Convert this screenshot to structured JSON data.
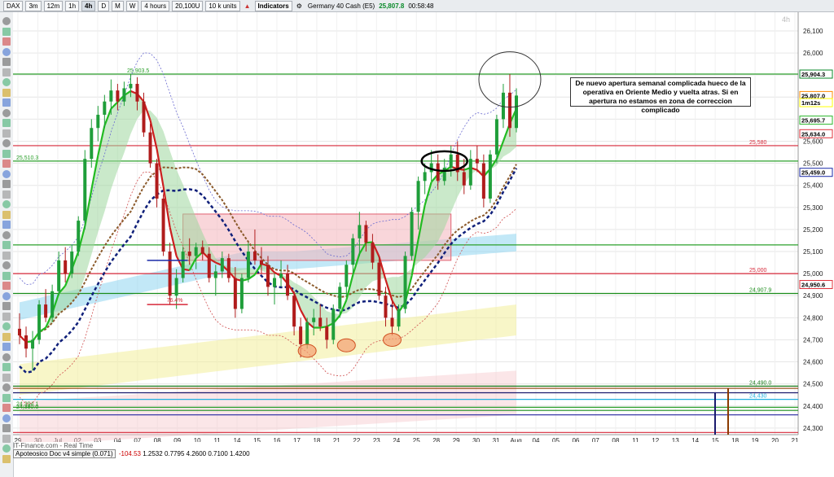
{
  "toolbar": {
    "instrument": "DAX",
    "timeframes": [
      "3m",
      "12m",
      "1h",
      "4h",
      "D",
      "M",
      "W"
    ],
    "selected_timeframe": "4h",
    "period": "4 hours",
    "quantity": "20,100U",
    "units": "10 k units",
    "indicators_label": "Indicators",
    "instrument_full": "Germany 40 Cash (E5)",
    "price": "25,807.8",
    "countdown": "00:58:48"
  },
  "watermark": "4h",
  "annotation_text": "De nuevo apertura semanal complicada  hueco de la operativa en Oriente Medio y vuelta atras. Si en apertura no estamos en zona de correccion complicado",
  "footer": {
    "source": "IT-Finance.com - Real Time",
    "indicator_name": "Apoteosico Doc v4 simple (0.071)",
    "values": [
      "-104.53",
      "1.2532",
      "0.7795",
      "4.2600",
      "0.7100",
      "1.4200"
    ]
  },
  "chart_data": {
    "type": "candlestick",
    "instrument": "DAX",
    "timeframe": "4h",
    "x_axis_labels": [
      "29",
      "30",
      "Jul",
      "02",
      "03",
      "04",
      "07",
      "08",
      "09",
      "10",
      "11",
      "14",
      "15",
      "16",
      "17",
      "18",
      "21",
      "22",
      "23",
      "24",
      "25",
      "28",
      "29",
      "30",
      "31",
      "Aug",
      "04",
      "05",
      "06",
      "07",
      "08",
      "11",
      "12",
      "13",
      "14",
      "15",
      "18",
      "19",
      "20",
      "21"
    ],
    "y_axis_ticks": [
      "26,100",
      "26,000",
      "25,900",
      "25,800",
      "25,700",
      "25,600",
      "25,500",
      "25,400",
      "25,300",
      "25,200",
      "25,100",
      "25,000",
      "24,900",
      "24,800",
      "24,700",
      "24,600",
      "24,500",
      "24,400",
      "24,300"
    ],
    "ylim": [
      24270,
      26170
    ],
    "price_tags": [
      {
        "text": "25,904.3",
        "value": 25904.3,
        "color": "#0a8a2a"
      },
      {
        "text": "25,807.0",
        "value": 25807,
        "color": "#ff8c00"
      },
      {
        "text": "1m12s",
        "value": 25775,
        "color": "#ffff00"
      },
      {
        "text": "25,695.7",
        "value": 25695.7,
        "color": "#2eb82e"
      },
      {
        "text": "25,634.0",
        "value": 25634,
        "color": "#e0303a"
      },
      {
        "text": "25,459.0",
        "value": 25459,
        "color": "#1a2aa8"
      },
      {
        "text": "24,950.6",
        "value": 24950.6,
        "color": "#e0303a"
      }
    ],
    "horizontal_levels": [
      {
        "value": 25904.3,
        "color": "#2ca02c",
        "label": "25,903.5"
      },
      {
        "value": 25580,
        "color": "#d62839",
        "label": "25,580"
      },
      {
        "value": 25510,
        "color": "#2ca02c",
        "label": "25,510.3"
      },
      {
        "value": 25130,
        "color": "#2ca02c",
        "label": ""
      },
      {
        "value": 25000,
        "color": "#d62839",
        "label": "25,000"
      },
      {
        "value": 24910,
        "color": "#1a8c1a",
        "label": "24,907.9"
      },
      {
        "value": 24490,
        "color": "#1a7a1a",
        "label": "24,490.0"
      },
      {
        "value": 24480,
        "color": "#8b3a00",
        "label": ""
      },
      {
        "value": 24460,
        "color": "#1a1a6e",
        "label": ""
      },
      {
        "value": 24430,
        "color": "#22b0e0",
        "label": "24,430"
      },
      {
        "value": 24394.1,
        "color": "#2ca02c",
        "label": "24,394.1"
      },
      {
        "value": 24380,
        "color": "#1a8c1a",
        "label": "24,380.0"
      },
      {
        "value": 24360,
        "color": "#3a3aa8",
        "label": ""
      },
      {
        "value": 24280,
        "color": "#d62839",
        "label": ""
      }
    ],
    "fib_label": "76.4%",
    "series": [
      {
        "type": "ohlc",
        "points": [
          [
            24750,
            24820,
            24680,
            24720
          ],
          [
            24720,
            24760,
            24620,
            24660
          ],
          [
            24660,
            24740,
            24560,
            24700
          ],
          [
            24700,
            24880,
            24680,
            24860
          ],
          [
            24860,
            24930,
            24780,
            24800
          ],
          [
            24800,
            24950,
            24780,
            24920
          ],
          [
            24920,
            25100,
            24900,
            25060
          ],
          [
            25060,
            25120,
            24960,
            25000
          ],
          [
            25000,
            25130,
            24980,
            25100
          ],
          [
            25100,
            25260,
            25080,
            25240
          ],
          [
            25240,
            25560,
            25200,
            25520
          ],
          [
            25520,
            25700,
            25480,
            25660
          ],
          [
            25660,
            25760,
            25600,
            25720
          ],
          [
            25720,
            25810,
            25660,
            25780
          ],
          [
            25780,
            25880,
            25720,
            25830
          ],
          [
            25830,
            25860,
            25740,
            25780
          ],
          [
            25780,
            25870,
            25760,
            25840
          ],
          [
            25840,
            25903,
            25800,
            25860
          ],
          [
            25860,
            25890,
            25740,
            25780
          ],
          [
            25780,
            25820,
            25620,
            25640
          ],
          [
            25640,
            25680,
            25480,
            25500
          ],
          [
            25500,
            25520,
            25300,
            25340
          ],
          [
            25340,
            25360,
            25080,
            25100
          ],
          [
            25100,
            25140,
            24860,
            24900
          ],
          [
            24900,
            25020,
            24840,
            24980
          ],
          [
            24980,
            25120,
            24960,
            25100
          ],
          [
            25100,
            25160,
            25040,
            25080
          ],
          [
            25080,
            25140,
            25020,
            25120
          ],
          [
            25120,
            25150,
            25060,
            25090
          ],
          [
            25090,
            25120,
            24960,
            24980
          ],
          [
            24980,
            25040,
            24900,
            25010
          ],
          [
            25010,
            25100,
            24980,
            25070
          ],
          [
            25070,
            25090,
            24960,
            24980
          ],
          [
            24980,
            25030,
            24800,
            24840
          ],
          [
            24840,
            25000,
            24820,
            24980
          ],
          [
            24980,
            25140,
            24960,
            25100
          ],
          [
            25100,
            25200,
            25040,
            25060
          ],
          [
            25060,
            25120,
            25000,
            25040
          ],
          [
            25040,
            25080,
            24900,
            24940
          ],
          [
            24940,
            25000,
            24860,
            24980
          ],
          [
            24980,
            25060,
            24940,
            25000
          ],
          [
            25000,
            25040,
            24880,
            24900
          ],
          [
            24900,
            24920,
            24720,
            24760
          ],
          [
            24760,
            24800,
            24620,
            24680
          ],
          [
            24680,
            24800,
            24660,
            24780
          ],
          [
            24780,
            24840,
            24720,
            24800
          ],
          [
            24800,
            24860,
            24740,
            24760
          ],
          [
            24760,
            24800,
            24660,
            24700
          ],
          [
            24700,
            24860,
            24680,
            24840
          ],
          [
            24840,
            24960,
            24800,
            24940
          ],
          [
            24940,
            25060,
            24900,
            25040
          ],
          [
            25040,
            25180,
            25000,
            25160
          ],
          [
            25160,
            25280,
            25080,
            25220
          ],
          [
            25220,
            25240,
            25100,
            25140
          ],
          [
            25140,
            25180,
            25020,
            25050
          ],
          [
            25050,
            25080,
            24880,
            24900
          ],
          [
            24900,
            24940,
            24760,
            24800
          ],
          [
            24800,
            24880,
            24720,
            24760
          ],
          [
            24760,
            24860,
            24740,
            24840
          ],
          [
            24840,
            25100,
            24820,
            25080
          ],
          [
            25080,
            25300,
            25060,
            25280
          ],
          [
            25280,
            25440,
            25200,
            25420
          ],
          [
            25420,
            25500,
            25360,
            25460
          ],
          [
            25460,
            25560,
            25420,
            25500
          ],
          [
            25500,
            25540,
            25380,
            25420
          ],
          [
            25420,
            25520,
            25400,
            25480
          ],
          [
            25480,
            25580,
            25440,
            25540
          ],
          [
            25540,
            25600,
            25420,
            25460
          ],
          [
            25460,
            25520,
            25360,
            25400
          ],
          [
            25400,
            25560,
            25380,
            25520
          ],
          [
            25520,
            25580,
            25460,
            25500
          ],
          [
            25500,
            25540,
            25300,
            25340
          ],
          [
            25340,
            25560,
            25320,
            25540
          ],
          [
            25540,
            25720,
            25500,
            25700
          ],
          [
            25700,
            25860,
            25660,
            25820
          ],
          [
            25820,
            25904,
            25620,
            25660
          ],
          [
            25660,
            25840,
            25640,
            25807
          ]
        ]
      }
    ]
  }
}
